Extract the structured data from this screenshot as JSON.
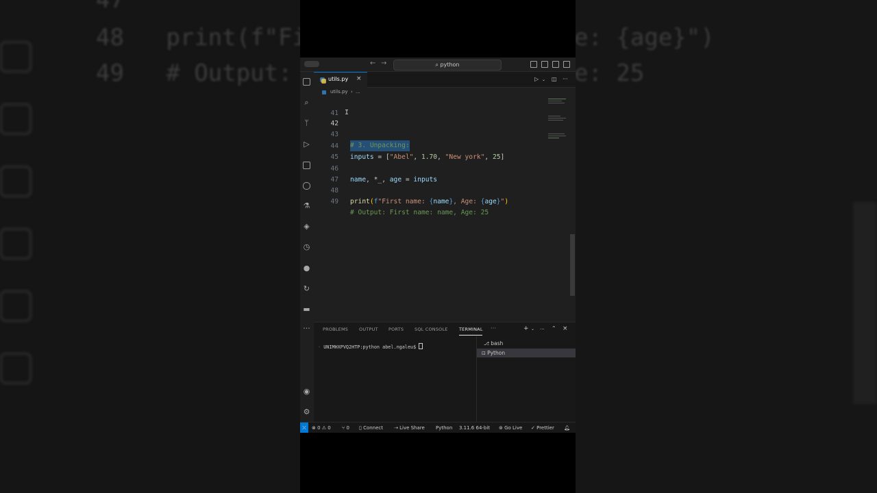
{
  "background": {
    "left_code": [
      {
        "ln": "47",
        "text": ""
      },
      {
        "ln": "48",
        "text": "print(f\"Fi"
      },
      {
        "ln": "49",
        "text": "# Output:"
      }
    ],
    "right_code": [
      {
        "text": "e: {age}\")"
      },
      {
        "text": "e: 25"
      }
    ]
  },
  "window": {
    "command_center": "python",
    "tab": {
      "label": "utils.py",
      "close": "×"
    },
    "breadcrumb": {
      "file": "utils.py",
      "more": "..."
    }
  },
  "editor": {
    "lines": [
      {
        "n": "41"
      },
      {
        "n": "42",
        "comment": "# 3. Unpacking:"
      },
      {
        "n": "43"
      },
      {
        "n": "44",
        "var": "inputs",
        "eq": " = [",
        "s1": "\"Abel\"",
        "c1": ", ",
        "num1": "1.70",
        "c2": ", ",
        "s2": "\"New york\"",
        "c3": ", ",
        "num2": "25",
        "end": "]"
      },
      {
        "n": "45"
      },
      {
        "n": "46",
        "a": "name",
        "b": ", *_, ",
        "c": "age",
        "d": " = ",
        "e": "inputs"
      },
      {
        "n": "47"
      },
      {
        "n": "48",
        "fn": "print",
        "p1": "(",
        "f": "f",
        "s_a": "\"First name: ",
        "o1": "{",
        "v1": "name",
        "c1": "}",
        "s_b": ", Age: ",
        "o2": "{",
        "v2": "age",
        "c2": "}",
        "s_c": "\"",
        "p2": ")"
      },
      {
        "n": "49",
        "comment": "# Output: First name: name, Age: 25"
      }
    ],
    "cursor_glyph": "I"
  },
  "panel": {
    "tabs": [
      "PROBLEMS",
      "OUTPUT",
      "PORTS",
      "SQL CONSOLE",
      "TERMINAL"
    ],
    "active_tab": "TERMINAL",
    "more": "···",
    "terminal_prompt": "UNIMHXPVQ2HTP:python abel.ngaleu$ ",
    "terminals": [
      "bash",
      "Python"
    ]
  },
  "status": {
    "errors": "0",
    "warnings": "0",
    "ports": "0",
    "connect": "Connect",
    "live_share": "Live Share",
    "language": "Python",
    "version": "3.11.6 64-bit",
    "go_live": "Go Live",
    "prettier": "Prettier"
  },
  "colors": {
    "accent": "#0078d4",
    "selection": "#264f78",
    "comment": "#6a9955",
    "string": "#ce9178",
    "number": "#b5cea8",
    "variable": "#9cdcfe",
    "function": "#dcdcaa"
  },
  "icons": [
    "explorer-icon",
    "search-icon",
    "source-control-icon",
    "run-debug-icon",
    "extensions-icon",
    "remote-explorer-icon",
    "testing-icon",
    "python-icon",
    "timeline-icon",
    "github-icon",
    "live-share-icon",
    "docker-icon",
    "accounts-icon",
    "settings-gear-icon"
  ]
}
